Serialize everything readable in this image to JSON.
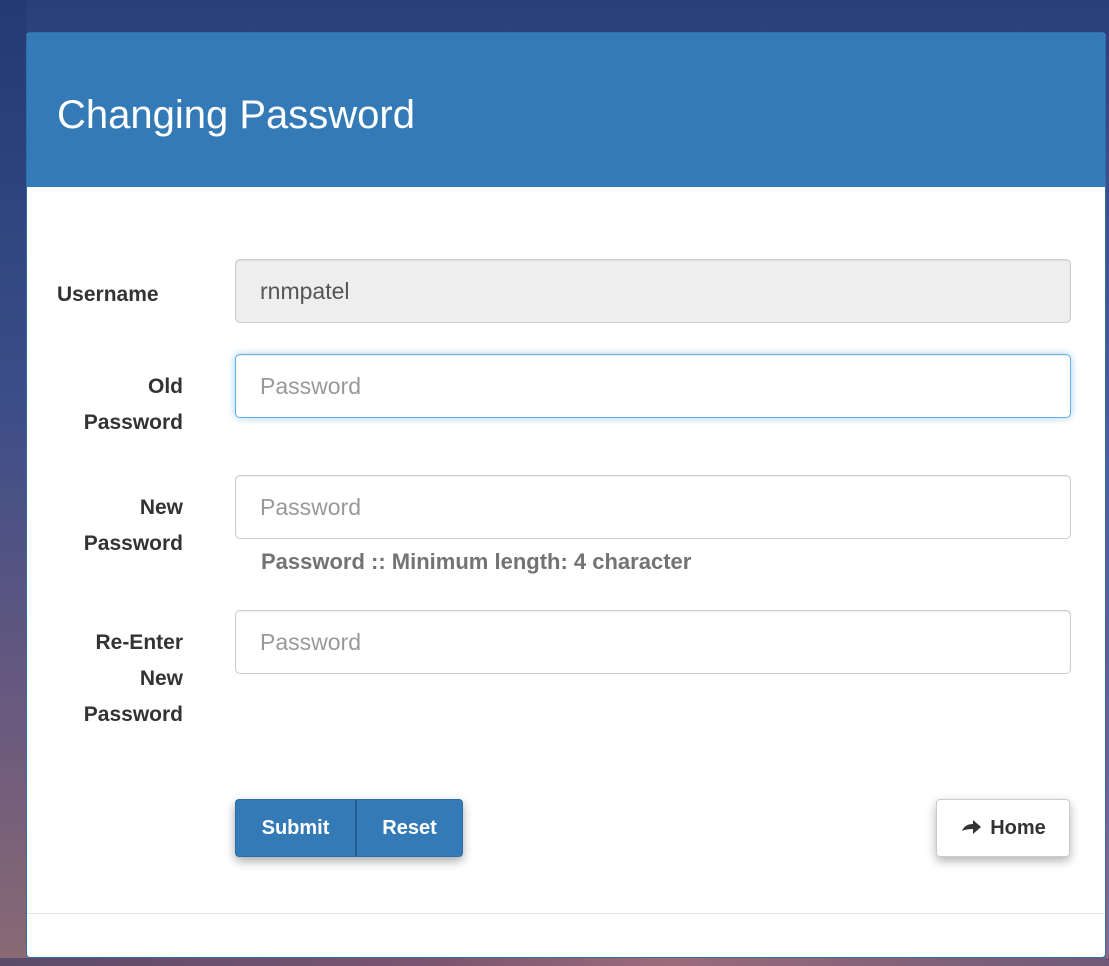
{
  "panel": {
    "title": "Changing Password"
  },
  "form": {
    "username": {
      "label": "Username",
      "value": "rnmpatel"
    },
    "old_password": {
      "label_line1": "Old",
      "label_line2": "Password",
      "placeholder": "Password"
    },
    "new_password": {
      "label_line1": "New",
      "label_line2": "Password",
      "placeholder": "Password",
      "help": "Password :: Minimum length: 4 character"
    },
    "reenter_password": {
      "label_line1": "Re-Enter",
      "label_line2": "New",
      "label_line3": "Password",
      "placeholder": "Password"
    }
  },
  "actions": {
    "submit_label": "Submit",
    "reset_label": "Reset",
    "home_label": "Home",
    "home_icon": "arrow-right-icon"
  },
  "colors": {
    "primary": "#337ab7",
    "heading_text": "#ffffff",
    "readonly_bg": "#eeeeee",
    "focus_border": "#66afe9"
  }
}
